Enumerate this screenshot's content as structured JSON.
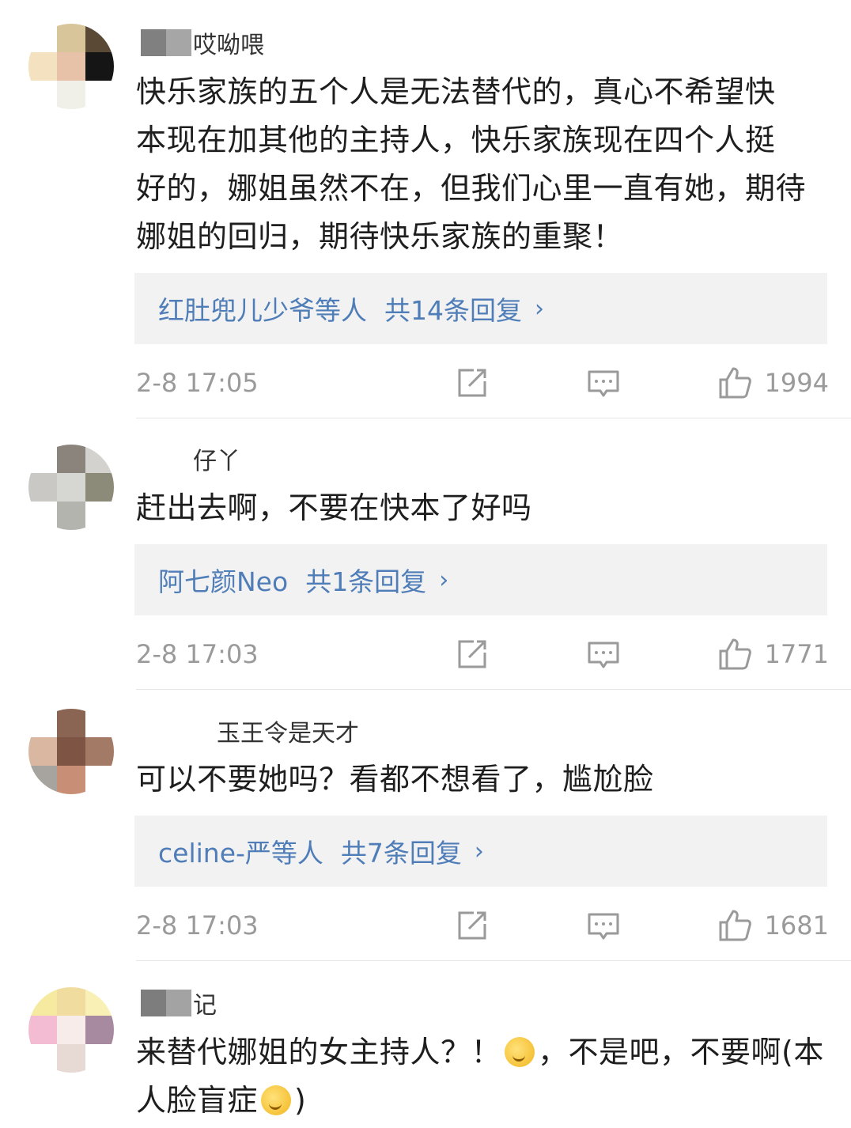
{
  "comments": [
    {
      "username_visible": "哎呦喂",
      "text": [
        "快乐家族的五个人是无法替代的，真心不希望快",
        "本现在加其他的主持人，快乐家族现在四个人挺",
        "好的，娜姐虽然不在，但我们心里一直有她，期待",
        "娜姐的回归，期待快乐家族的重聚！"
      ],
      "reply_names": "红肚兜儿少爷等人",
      "reply_count": "共14条回复",
      "time": "2-8 17:05",
      "likes": "1994",
      "avatar_colors": [
        "#ffffff",
        "#d8c59a",
        "#5a4a35",
        "#f3e1c0",
        "#e8c2a8",
        "#151515",
        "#ffffff",
        "#f0efe8",
        "#ffffff"
      ]
    },
    {
      "username_visible": "仔丫",
      "text": [
        "赶出去啊，不要在快本了好吗"
      ],
      "reply_names": "阿七颜Neo",
      "reply_count": "共1条回复",
      "time": "2-8 17:03",
      "likes": "1771",
      "avatar_colors": [
        "#ffffff",
        "#8b847c",
        "#d4d2cf",
        "#c9c8c4",
        "#d6d6d2",
        "#8c8a78",
        "#ffffff",
        "#b3b4ae",
        "#ffffff"
      ]
    },
    {
      "username_visible": "玉王令是天才",
      "text": [
        "可以不要她吗？看都不想看了，尴尬脸"
      ],
      "reply_names": "celine-严等人",
      "reply_count": "共7条回复",
      "time": "2-8 17:03",
      "likes": "1681",
      "avatar_colors": [
        "#ffffff",
        "#8a6554",
        "#ffffff",
        "#d9b7a0",
        "#7e5444",
        "#a27a66",
        "#a7a39e",
        "#c98f76",
        "#ffffff"
      ]
    },
    {
      "username_visible": "记",
      "text_line1": "来替代娜姐的女主持人？！",
      "text_line1_tail": "，不是吧，不要啊(本",
      "text_line2": "人脸盲症",
      "text_line2_tail": ")",
      "avatar_colors": [
        "#f5eaa0",
        "#f1dca0",
        "#f9f0b5",
        "#f4bcd2",
        "#f7ecea",
        "#a88aa0",
        "#ffffff",
        "#e7d9d3",
        "#ffffff"
      ]
    }
  ],
  "icons": [
    "share-icon",
    "comment-icon",
    "like-icon"
  ],
  "colors": {
    "link": "#4f7db8",
    "meta": "#9a9a9a",
    "reply_bg": "#f2f2f2"
  }
}
